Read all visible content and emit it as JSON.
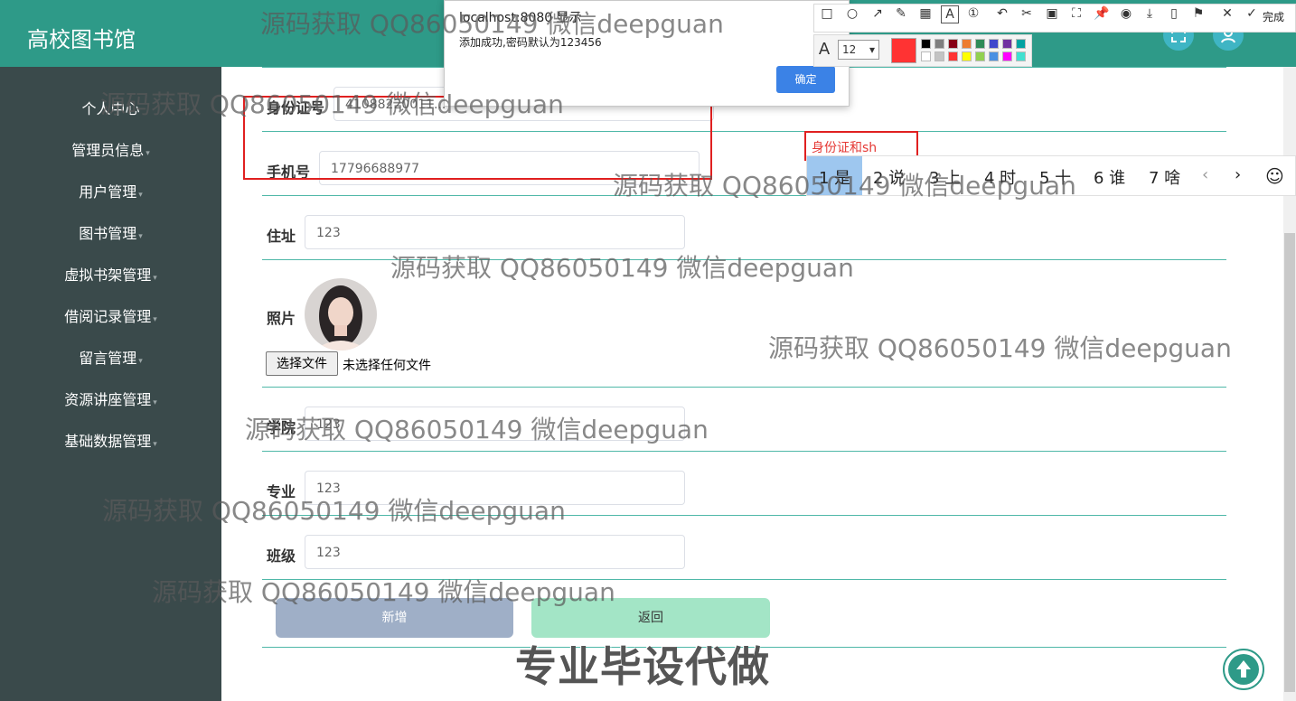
{
  "app": {
    "title": "高校图书馆"
  },
  "sidebar": {
    "items": [
      {
        "label": "个人中心",
        "has_caret": false
      },
      {
        "label": "管理员信息",
        "has_caret": true
      },
      {
        "label": "用户管理",
        "has_caret": true
      },
      {
        "label": "图书管理",
        "has_caret": true
      },
      {
        "label": "虚拟书架管理",
        "has_caret": true
      },
      {
        "label": "借阅记录管理",
        "has_caret": true
      },
      {
        "label": "留言管理",
        "has_caret": true
      },
      {
        "label": "资源讲座管理",
        "has_caret": true
      },
      {
        "label": "基础数据管理",
        "has_caret": true
      }
    ],
    "caret_glyph": "▾"
  },
  "form": {
    "id_card": {
      "label": "身份证号",
      "value": "41088220011..."
    },
    "phone": {
      "label": "手机号",
      "value": "17796688977"
    },
    "address": {
      "label": "住址",
      "value": "123"
    },
    "photo": {
      "label": "照片"
    },
    "file": {
      "button": "选择文件",
      "status": "未选择任何文件"
    },
    "college": {
      "label": "学院",
      "value": "123"
    },
    "major": {
      "label": "专业",
      "value": "123"
    },
    "class": {
      "label": "班级",
      "value": "123"
    }
  },
  "actions": {
    "add": "新增",
    "back": "返回"
  },
  "dialog": {
    "title": "localhost:8080 显示",
    "message": "添加成功,密码默认为123456",
    "ok": "确定"
  },
  "snip_tool": {
    "done": "完成",
    "font_size": "12",
    "font_icon_label": "A",
    "colors_row1": [
      "#000000",
      "#7f7f7f",
      "#880015",
      "#ed7d31",
      "#2e8b57",
      "#3f48cc",
      "#7030a0",
      "#00a2a2"
    ],
    "colors_row2": [
      "#ffffff",
      "#c3c3c3",
      "#ff3333",
      "#ffff00",
      "#92d050",
      "#4a90e2",
      "#ff00ff",
      "#40e0d0"
    ]
  },
  "ime": {
    "input_text": "身份证和sh",
    "candidates": [
      "1 是",
      "2 说",
      "3 上",
      "4 时",
      "5 十",
      "6 谁",
      "7 啥"
    ],
    "prev": "‹",
    "next": "›",
    "emoji": "☺"
  },
  "watermarks": {
    "repeated": "源码获取 QQ86050149 微信deepguan",
    "big": "专业毕设代做"
  }
}
